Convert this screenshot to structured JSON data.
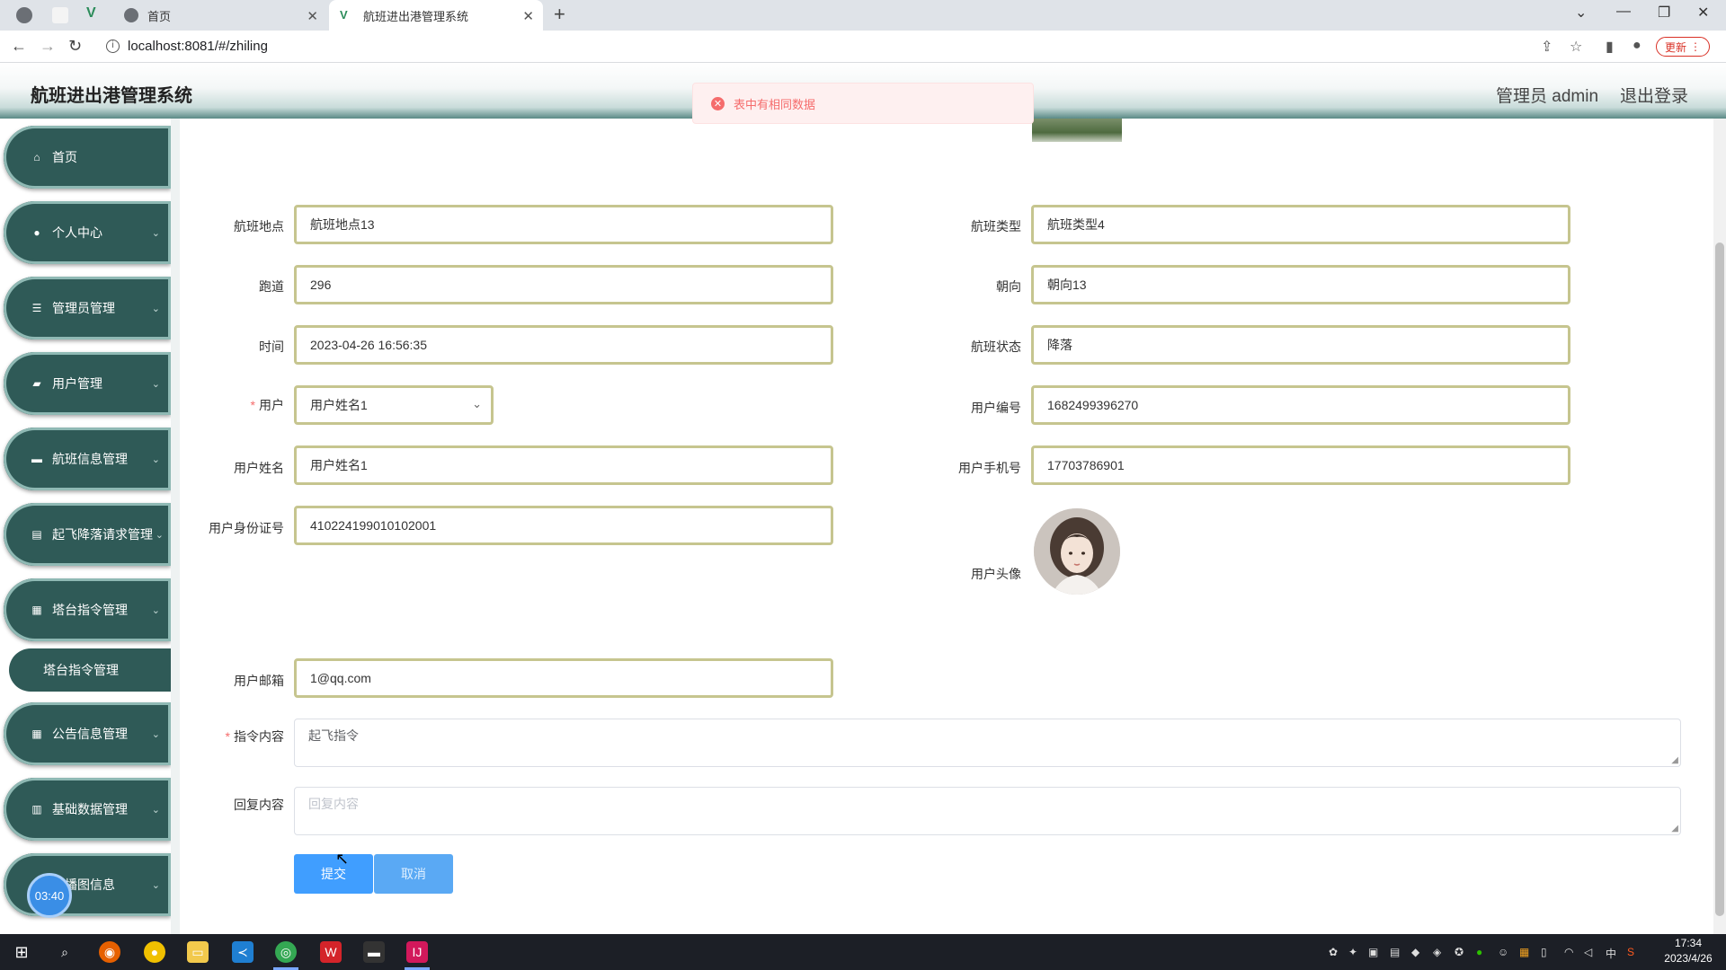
{
  "browser": {
    "tabs": [
      {
        "label": "首页",
        "active": false
      },
      {
        "label": "航班进出港管理系统",
        "active": true
      }
    ],
    "url": "localhost:8081/#/zhiling",
    "update_label": "更新"
  },
  "app": {
    "title": "航班进出港管理系统",
    "admin_label": "管理员 admin",
    "logout_label": "退出登录"
  },
  "toast": {
    "message": "表中有相同数据",
    "type": "error",
    "color": "#f56c6c"
  },
  "sidebar": {
    "items": [
      {
        "label": "首页",
        "icon": "home-icon"
      },
      {
        "label": "个人中心",
        "icon": "user-icon"
      },
      {
        "label": "管理员管理",
        "icon": "list-icon"
      },
      {
        "label": "用户管理",
        "icon": "users-icon"
      },
      {
        "label": "航班信息管理",
        "icon": "document-icon"
      },
      {
        "label": "起飞降落请求管理",
        "icon": "briefcase-icon"
      },
      {
        "label": "塔台指令管理",
        "icon": "grid-icon"
      },
      {
        "label": "公告信息管理",
        "icon": "grid-icon"
      },
      {
        "label": "基础数据管理",
        "icon": "chart-icon"
      },
      {
        "label": "轮播图信息",
        "icon": "image-icon"
      }
    ],
    "submenu": {
      "label": "塔台指令管理"
    },
    "timer": "03:40"
  },
  "form": {
    "flight_location": {
      "label": "航班地点",
      "value": "航班地点13"
    },
    "flight_type": {
      "label": "航班类型",
      "value": "航班类型4"
    },
    "runway": {
      "label": "跑道",
      "value": "296"
    },
    "direction": {
      "label": "朝向",
      "value": "朝向13"
    },
    "time": {
      "label": "时间",
      "value": "2023-04-26 16:56:35"
    },
    "flight_status": {
      "label": "航班状态",
      "value": "降落"
    },
    "user": {
      "label": "用户",
      "value": "用户姓名1"
    },
    "user_id": {
      "label": "用户编号",
      "value": "1682499396270"
    },
    "user_name": {
      "label": "用户姓名",
      "value": "用户姓名1"
    },
    "user_phone": {
      "label": "用户手机号",
      "value": "17703786901"
    },
    "user_idcard": {
      "label": "用户身份证号",
      "value": "410224199010102001"
    },
    "user_avatar": {
      "label": "用户头像"
    },
    "user_email": {
      "label": "用户邮箱",
      "value": "1@qq.com"
    },
    "command": {
      "label": "指令内容",
      "value": "起飞指令"
    },
    "reply": {
      "label": "回复内容",
      "placeholder": "回复内容"
    },
    "submit_label": "提交",
    "cancel_label": "取消"
  },
  "taskbar": {
    "clock_time": "17:34",
    "clock_date": "2023/4/26",
    "ime": "中"
  },
  "colors": {
    "accent": "#409eff",
    "sidebar": "#2f5a57",
    "input_border": "#c6c58f",
    "error": "#f56c6c"
  }
}
